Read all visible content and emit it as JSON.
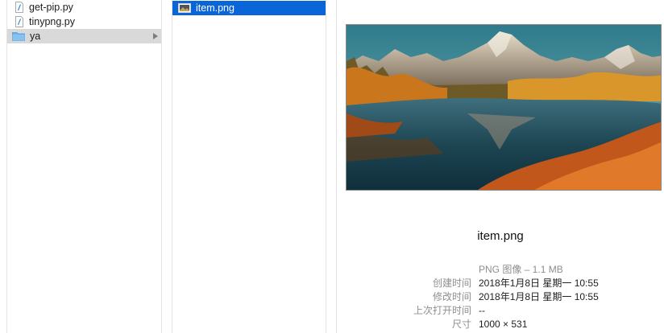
{
  "column1": {
    "items": [
      {
        "label": "get-pip.py",
        "icon": "python-file-icon"
      },
      {
        "label": "tinypng.py",
        "icon": "python-file-icon"
      },
      {
        "label": "ya",
        "icon": "folder-icon"
      }
    ]
  },
  "column2": {
    "items": [
      {
        "label": "item.png",
        "icon": "image-file-icon"
      }
    ]
  },
  "preview": {
    "thumbnail": "mountain-lake-autumn-image",
    "filename": "item.png",
    "kind": "PNG 图像 – 1.1 MB",
    "created_label": "创建时间",
    "created_value": "2018年1月8日 星期一 10:55",
    "modified_label": "修改时间",
    "modified_value": "2018年1月8日 星期一 10:55",
    "opened_label": "上次打开时间",
    "opened_value": "--",
    "dimensions_label": "尺寸",
    "dimensions_value": "1000 × 531"
  },
  "colors": {
    "selection_blue": "#0a66d8",
    "selection_gray": "#d9d9d9",
    "folder_blue": "#6fb3ec"
  }
}
